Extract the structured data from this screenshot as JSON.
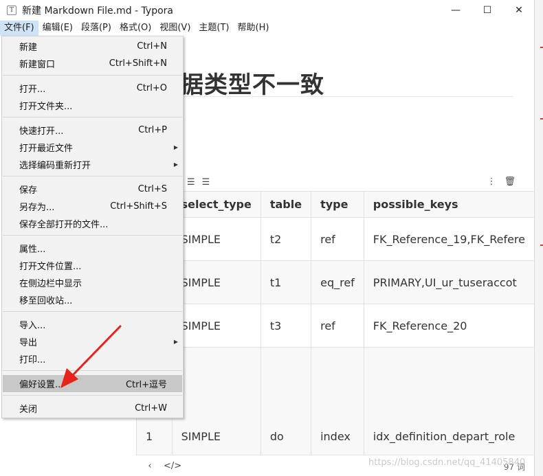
{
  "window": {
    "title": "新建 Markdown File.md - Typora",
    "app_icon_glyph": "T",
    "controls": [
      "—",
      "☐",
      "✕"
    ]
  },
  "menubar": [
    "文件(F)",
    "编辑(E)",
    "段落(P)",
    "格式(O)",
    "视图(V)",
    "主题(T)",
    "帮助(H)"
  ],
  "file_menu": {
    "groups": [
      [
        {
          "label": "新建",
          "shortcut": "Ctrl+N"
        },
        {
          "label": "新建窗口",
          "shortcut": "Ctrl+Shift+N"
        }
      ],
      [
        {
          "label": "打开...",
          "shortcut": "Ctrl+O"
        },
        {
          "label": "打开文件夹...",
          "shortcut": ""
        }
      ],
      [
        {
          "label": "快速打开...",
          "shortcut": "Ctrl+P"
        },
        {
          "label": "打开最近文件",
          "shortcut": "",
          "submenu": true
        },
        {
          "label": "选择编码重新打开",
          "shortcut": "",
          "submenu": true
        }
      ],
      [
        {
          "label": "保存",
          "shortcut": "Ctrl+S"
        },
        {
          "label": "另存为...",
          "shortcut": "Ctrl+Shift+S"
        },
        {
          "label": "保存全部打开的文件...",
          "shortcut": ""
        }
      ],
      [
        {
          "label": "属性...",
          "shortcut": ""
        },
        {
          "label": "打开文件位置...",
          "shortcut": ""
        },
        {
          "label": "在侧边栏中显示",
          "shortcut": ""
        },
        {
          "label": "移至回收站...",
          "shortcut": ""
        }
      ],
      [
        {
          "label": "导入...",
          "shortcut": ""
        },
        {
          "label": "导出",
          "shortcut": "",
          "submenu": true
        },
        {
          "label": "打印...",
          "shortcut": ""
        }
      ],
      [
        {
          "label": "偏好设置...",
          "shortcut": "Ctrl+逗号",
          "highlighted": true
        }
      ],
      [
        {
          "label": "关闭",
          "shortcut": "Ctrl+W"
        }
      ]
    ]
  },
  "document": {
    "heading": "据类型不一致",
    "table": {
      "headers": [
        "",
        "select_type",
        "table",
        "type",
        "possible_keys"
      ],
      "rows": [
        [
          "",
          "SIMPLE",
          "t2",
          "ref",
          "FK_Reference_19,FK_Refere"
        ],
        [
          "",
          "SIMPLE",
          "t1",
          "eq_ref",
          "PRIMARY,UI_ur_tuseraccot"
        ],
        [
          "",
          "SIMPLE",
          "t3",
          "ref",
          "FK_Reference_20"
        ],
        [
          "1",
          "SIMPLE",
          "do",
          "index",
          "idx_definition_depart_role"
        ]
      ]
    }
  },
  "statusbar": {
    "word_count": "97 词",
    "watermark": "https://blog.csdn.net/qq_41405840"
  },
  "colors": {
    "menu_highlight": "#c8c8c8",
    "active_menu": "#cfe3f7",
    "annotation_arrow": "#e8211a"
  }
}
